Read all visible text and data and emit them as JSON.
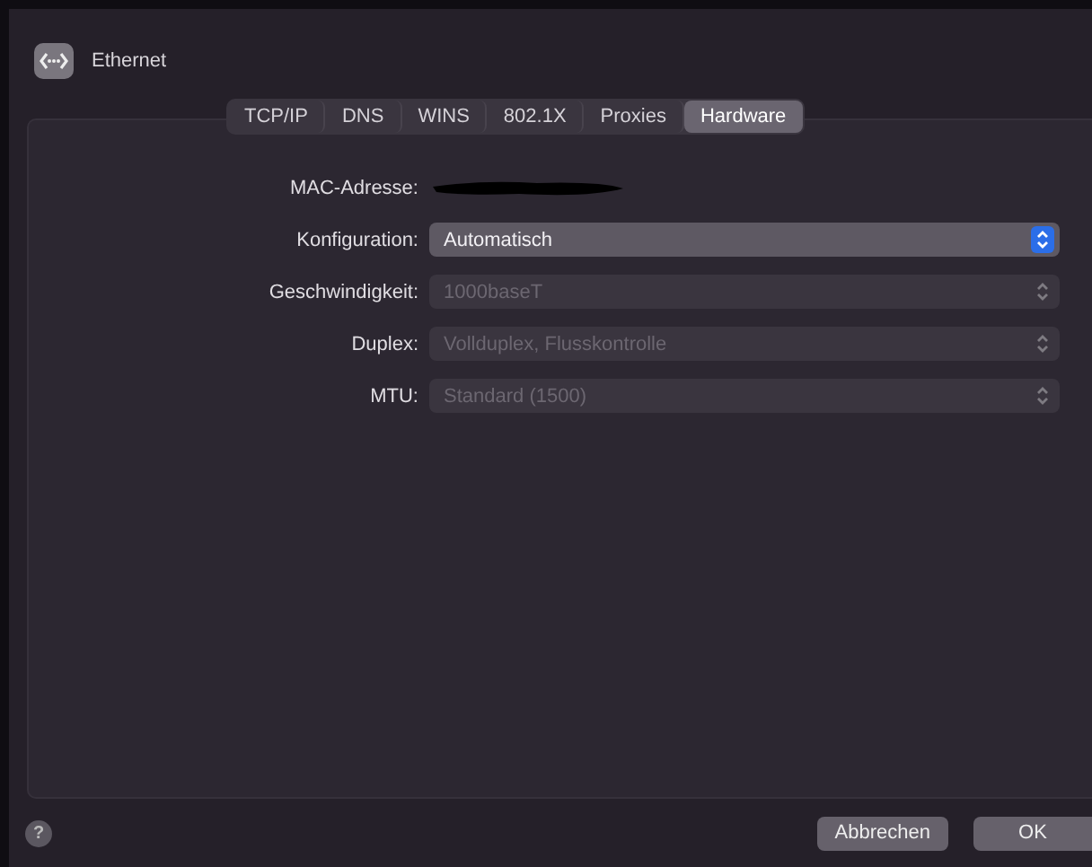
{
  "window": {
    "title": "Ethernet"
  },
  "tabs": [
    {
      "label": "TCP/IP",
      "selected": false
    },
    {
      "label": "DNS",
      "selected": false
    },
    {
      "label": "WINS",
      "selected": false
    },
    {
      "label": "802.1X",
      "selected": false
    },
    {
      "label": "Proxies",
      "selected": false
    },
    {
      "label": "Hardware",
      "selected": true
    }
  ],
  "form": [
    {
      "kind": "redacted",
      "label": "MAC-Adresse:"
    },
    {
      "kind": "popup",
      "label": "Konfiguration:",
      "value": "Automatisch",
      "disabled": false
    },
    {
      "kind": "popup",
      "label": "Geschwindigkeit:",
      "value": "1000baseT",
      "disabled": true
    },
    {
      "kind": "popup",
      "label": "Duplex:",
      "value": "Vollduplex, Flusskontrolle",
      "disabled": true
    },
    {
      "kind": "popup",
      "label": "MTU:",
      "value": "Standard (1500)",
      "disabled": true
    }
  ],
  "help": {
    "label": "?"
  },
  "buttons": [
    {
      "label": "Abbrechen"
    },
    {
      "label": "OK"
    }
  ]
}
